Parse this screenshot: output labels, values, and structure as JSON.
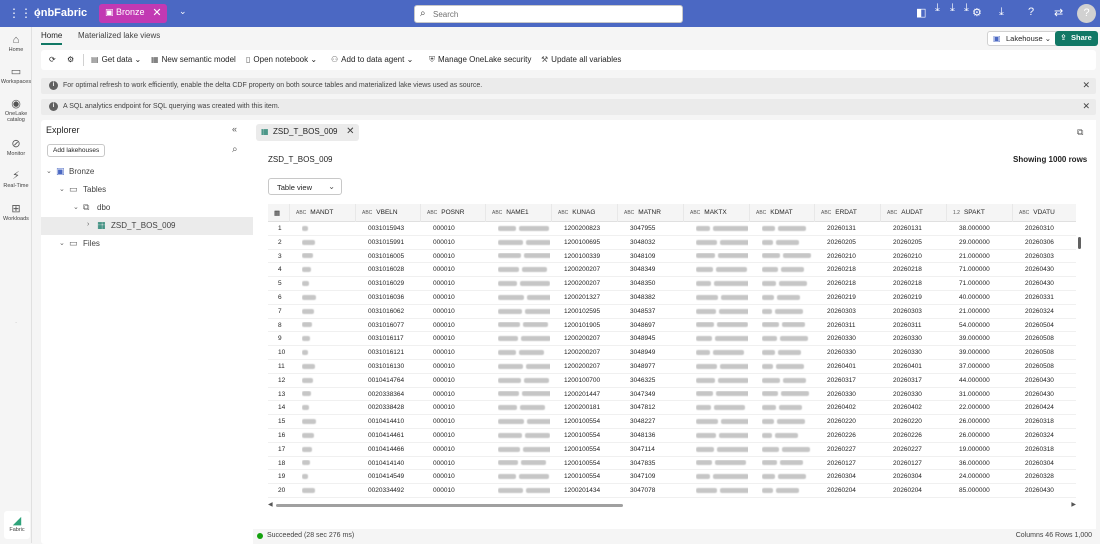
{
  "topbar": {
    "brand": "onbFabric",
    "workspace": "Bronze",
    "search_placeholder": "Search",
    "avatar_initial": "?"
  },
  "leftnav": {
    "items": [
      {
        "label": "Home",
        "icon": "home-icon"
      },
      {
        "label": "Workspaces",
        "icon": "workspaces-icon"
      },
      {
        "label": "OneLake catalog",
        "icon": "onelake-icon"
      },
      {
        "label": "Monitor",
        "icon": "monitor-icon"
      },
      {
        "label": "Real-Time",
        "icon": "realtime-icon"
      },
      {
        "label": "Workloads",
        "icon": "workloads-icon"
      }
    ],
    "footer_label": "Fabric"
  },
  "tabs": [
    {
      "label": "Home",
      "active": true
    },
    {
      "label": "Materialized lake views",
      "active": false
    }
  ],
  "header_actions": {
    "lakehouse_label": "Lakehouse",
    "share_label": "Share"
  },
  "toolbar": {
    "get_data": "Get data",
    "new_semantic_model": "New semantic model",
    "open_notebook": "Open notebook",
    "add_to_data_agent": "Add to data agent",
    "manage_security": "Manage OneLake security",
    "update_variables": "Update all variables"
  },
  "banners": [
    "For optimal refresh to work efficiently, enable the delta CDF property on both source tables and materialized lake views used as source.",
    "A SQL analytics endpoint for SQL querying was created with this item."
  ],
  "explorer": {
    "title": "Explorer",
    "add_lakehouses": "Add lakehouses",
    "tree": {
      "root": "Bronze",
      "tables": "Tables",
      "schema": "dbo",
      "table": "ZSD_T_BOS_009",
      "files": "Files"
    }
  },
  "content": {
    "tab_label": "ZSD_T_BOS_009",
    "table_title": "ZSD_T_BOS_009",
    "showing": "Showing 1000 rows",
    "view_mode": "Table view"
  },
  "grid": {
    "columns": [
      {
        "name": "MANDT",
        "type": "ABC"
      },
      {
        "name": "VBELN",
        "type": "ABC"
      },
      {
        "name": "POSNR",
        "type": "ABC"
      },
      {
        "name": "NAME1",
        "type": "ABC"
      },
      {
        "name": "KUNAG",
        "type": "ABC"
      },
      {
        "name": "MATNR",
        "type": "ABC"
      },
      {
        "name": "MAKTX",
        "type": "ABC"
      },
      {
        "name": "KDMAT",
        "type": "ABC"
      },
      {
        "name": "ERDAT",
        "type": "ABC"
      },
      {
        "name": "AUDAT",
        "type": "ABC"
      },
      {
        "name": "SPAKT",
        "type": "1.2"
      },
      {
        "name": "VDATU",
        "type": "ABC"
      }
    ],
    "rows": [
      {
        "n": "1",
        "vbeln": "0031015943",
        "posnr": "000010",
        "kunag": "1200200823",
        "matnr": "3047955",
        "erdat": "20260131",
        "audat": "20260131",
        "spakt": "38.000000",
        "vdatu": "20260310"
      },
      {
        "n": "2",
        "vbeln": "0031015991",
        "posnr": "000010",
        "kunag": "1200100695",
        "matnr": "3048032",
        "erdat": "20260205",
        "audat": "20260205",
        "spakt": "29.000000",
        "vdatu": "20260306"
      },
      {
        "n": "3",
        "vbeln": "0031016005",
        "posnr": "000010",
        "kunag": "1200100339",
        "matnr": "3048109",
        "erdat": "20260210",
        "audat": "20260210",
        "spakt": "21.000000",
        "vdatu": "20260303"
      },
      {
        "n": "4",
        "vbeln": "0031016028",
        "posnr": "000010",
        "kunag": "1200200207",
        "matnr": "3048349",
        "erdat": "20260218",
        "audat": "20260218",
        "spakt": "71.000000",
        "vdatu": "20260430"
      },
      {
        "n": "5",
        "vbeln": "0031016029",
        "posnr": "000010",
        "kunag": "1200200207",
        "matnr": "3048350",
        "erdat": "20260218",
        "audat": "20260218",
        "spakt": "71.000000",
        "vdatu": "20260430"
      },
      {
        "n": "6",
        "vbeln": "0031016036",
        "posnr": "000010",
        "kunag": "1200201327",
        "matnr": "3048382",
        "erdat": "20260219",
        "audat": "20260219",
        "spakt": "40.000000",
        "vdatu": "20260331"
      },
      {
        "n": "7",
        "vbeln": "0031016062",
        "posnr": "000010",
        "kunag": "1200102595",
        "matnr": "3048537",
        "erdat": "20260303",
        "audat": "20260303",
        "spakt": "21.000000",
        "vdatu": "20260324"
      },
      {
        "n": "8",
        "vbeln": "0031016077",
        "posnr": "000010",
        "kunag": "1200101905",
        "matnr": "3048697",
        "erdat": "20260311",
        "audat": "20260311",
        "spakt": "54.000000",
        "vdatu": "20260504"
      },
      {
        "n": "9",
        "vbeln": "0031016117",
        "posnr": "000010",
        "kunag": "1200200207",
        "matnr": "3048945",
        "erdat": "20260330",
        "audat": "20260330",
        "spakt": "39.000000",
        "vdatu": "20260508"
      },
      {
        "n": "10",
        "vbeln": "0031016121",
        "posnr": "000010",
        "kunag": "1200200207",
        "matnr": "3048949",
        "erdat": "20260330",
        "audat": "20260330",
        "spakt": "39.000000",
        "vdatu": "20260508"
      },
      {
        "n": "11",
        "vbeln": "0031016130",
        "posnr": "000010",
        "kunag": "1200200207",
        "matnr": "3048977",
        "erdat": "20260401",
        "audat": "20260401",
        "spakt": "37.000000",
        "vdatu": "20260508"
      },
      {
        "n": "12",
        "vbeln": "0010414764",
        "posnr": "000010",
        "kunag": "1200100700",
        "matnr": "3046325",
        "erdat": "20260317",
        "audat": "20260317",
        "spakt": "44.000000",
        "vdatu": "20260430"
      },
      {
        "n": "13",
        "vbeln": "0020338364",
        "posnr": "000010",
        "kunag": "1200201447",
        "matnr": "3047349",
        "erdat": "20260330",
        "audat": "20260330",
        "spakt": "31.000000",
        "vdatu": "20260430"
      },
      {
        "n": "14",
        "vbeln": "0020338428",
        "posnr": "000010",
        "kunag": "1200200181",
        "matnr": "3047812",
        "erdat": "20260402",
        "audat": "20260402",
        "spakt": "22.000000",
        "vdatu": "20260424"
      },
      {
        "n": "15",
        "vbeln": "0010414410",
        "posnr": "000010",
        "kunag": "1200100554",
        "matnr": "3048227",
        "erdat": "20260220",
        "audat": "20260220",
        "spakt": "26.000000",
        "vdatu": "20260318"
      },
      {
        "n": "16",
        "vbeln": "0010414461",
        "posnr": "000010",
        "kunag": "1200100554",
        "matnr": "3048136",
        "erdat": "20260226",
        "audat": "20260226",
        "spakt": "26.000000",
        "vdatu": "20260324"
      },
      {
        "n": "17",
        "vbeln": "0010414466",
        "posnr": "000010",
        "kunag": "1200100554",
        "matnr": "3047114",
        "erdat": "20260227",
        "audat": "20260227",
        "spakt": "19.000000",
        "vdatu": "20260318"
      },
      {
        "n": "18",
        "vbeln": "0010414140",
        "posnr": "000010",
        "kunag": "1200100554",
        "matnr": "3047835",
        "erdat": "20260127",
        "audat": "20260127",
        "spakt": "36.000000",
        "vdatu": "20260304"
      },
      {
        "n": "19",
        "vbeln": "0010414549",
        "posnr": "000010",
        "kunag": "1200100554",
        "matnr": "3047109",
        "erdat": "20260304",
        "audat": "20260304",
        "spakt": "24.000000",
        "vdatu": "20260328"
      },
      {
        "n": "20",
        "vbeln": "0020334492",
        "posnr": "000010",
        "kunag": "1200201434",
        "matnr": "3047078",
        "erdat": "20260204",
        "audat": "20260204",
        "spakt": "85.000000",
        "vdatu": "20260430"
      }
    ]
  },
  "status": {
    "message": "Succeeded (28 sec 276 ms)",
    "meta": "Columns 46 Rows 1,000"
  },
  "colors": {
    "topbar": "#4b68c3",
    "workspace_badge": "#c239b3",
    "accent": "#117865",
    "success": "#13a10e"
  }
}
